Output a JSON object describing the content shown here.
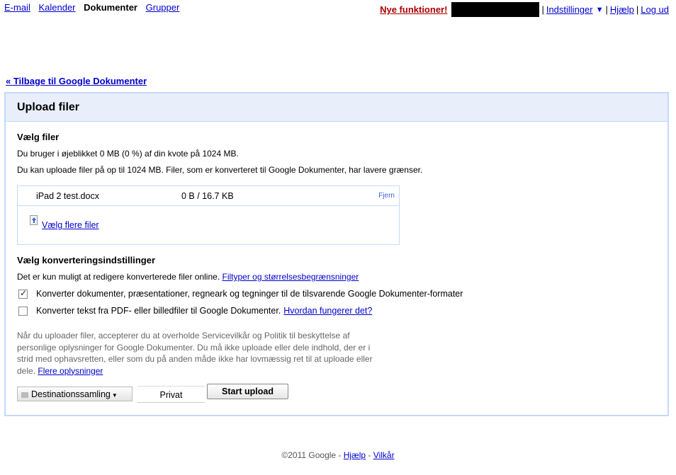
{
  "topnav": {
    "left": [
      "E-mail",
      "Kalender",
      "Dokumenter",
      "Grupper"
    ],
    "new_features": "Nye funktioner!",
    "settings": "Indstillinger",
    "help": "Hjælp",
    "logout": "Log ud"
  },
  "back_link": "« Tilbage til Google Dokumenter",
  "panel": {
    "title": "Upload filer",
    "choose_files_title": "Vælg filer",
    "quota_line": "Du bruger i øjeblikket 0 MB (0 %) af din kvote på 1024 MB.",
    "limit_line": "Du kan uploade filer på op til 1024 MB. Filer, som er konverteret til Google Dokumenter, har lavere grænser.",
    "file": {
      "name": "iPad 2 test.docx",
      "progress": "0 B / 16.7 KB",
      "remove": "Fjern"
    },
    "choose_more": "Vælg flere filer",
    "conversion_title": "Vælg konverteringsindstillinger",
    "conversion_note": "Det er kun muligt at redigere konverterede filer online.",
    "conversion_link": "Filtyper og størrelsesbegrænsninger",
    "option1": "Konverter dokumenter, præsentationer, regneark og tegninger til de tilsvarende Google Dokumenter-formater",
    "option1_checked": true,
    "option2": "Konverter tekst fra PDF- eller billedfiler til Google Dokumenter.",
    "option2_checked": false,
    "option2_link": "Hvordan fungerer det?",
    "terms": "Når du uploader filer, accepterer du at overholde Servicevilkår og Politik til beskyttelse af personlige oplysninger for Google Dokumenter. Du må ikke uploade eller dele indhold, der er i strid med ophavsretten, eller som du på anden måde ikke har lovmæssig ret til at uploade eller dele.",
    "terms_link": "Flere oplysninger",
    "destination_button": "Destinationssamling",
    "private_label": "Privat",
    "start_button": "Start upload"
  },
  "footer": {
    "copyright": "©2011 Google -",
    "help": "Hjælp",
    "dash": "-",
    "terms": "Vilkår"
  }
}
